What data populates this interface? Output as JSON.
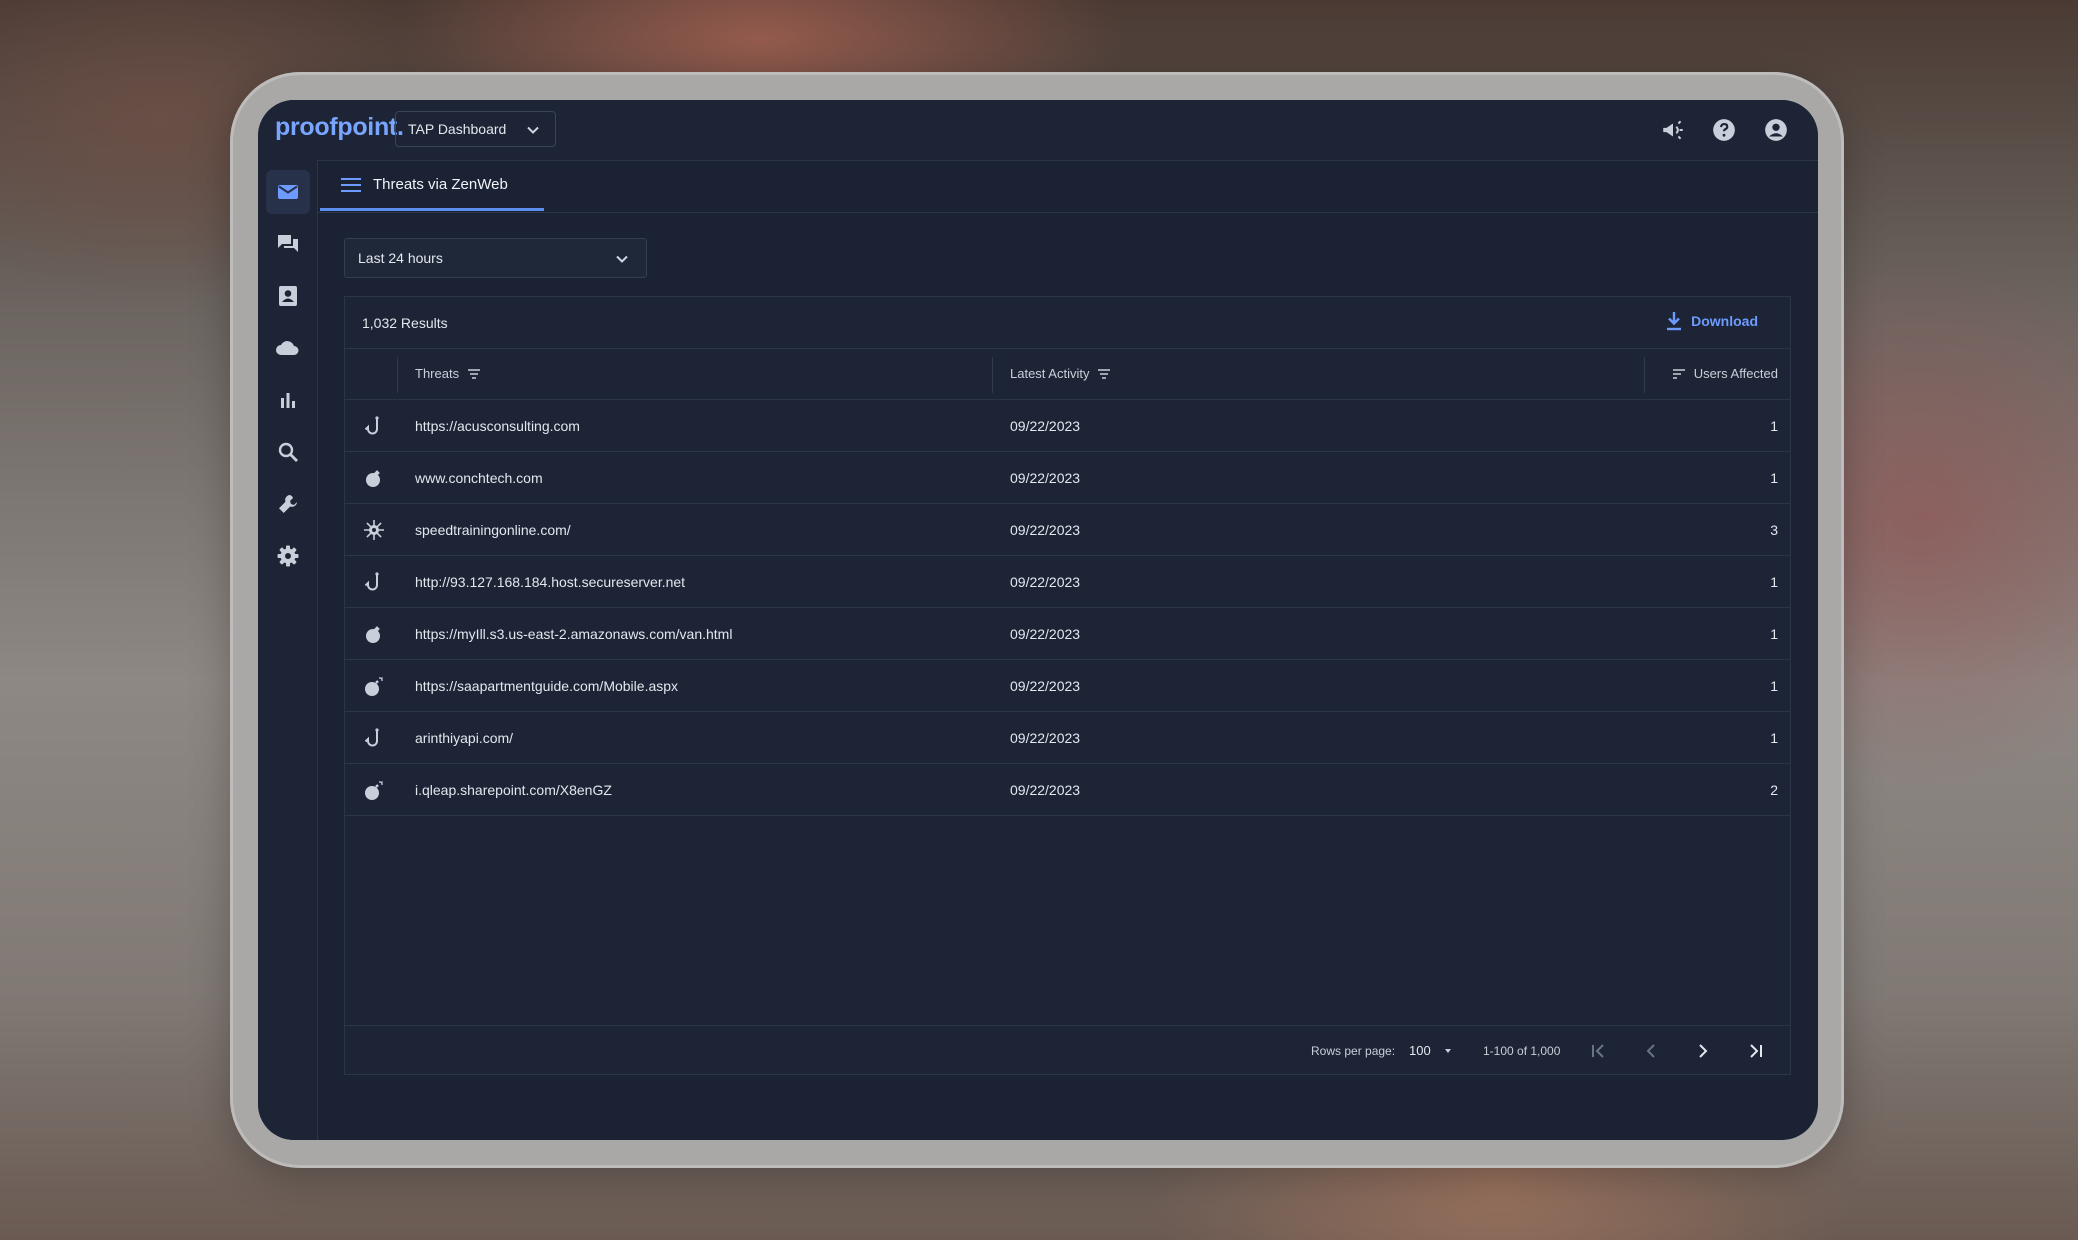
{
  "app": {
    "logo_text": "proofpoint.",
    "dashboard_selector": "TAP Dashboard",
    "accent_color": "#5b8def"
  },
  "topbar_icons": [
    "megaphone-icon",
    "help-icon",
    "account-icon"
  ],
  "sidebar": {
    "items": [
      {
        "icon": "mail-icon",
        "active": true
      },
      {
        "icon": "chat-icon",
        "active": false
      },
      {
        "icon": "contact-card-icon",
        "active": false
      },
      {
        "icon": "cloud-icon",
        "active": false
      },
      {
        "icon": "bar-chart-icon",
        "active": false
      },
      {
        "icon": "search-icon",
        "active": false
      },
      {
        "icon": "wrench-icon",
        "active": false
      },
      {
        "icon": "gear-icon",
        "active": false
      }
    ],
    "bottom_icon": "panel-toggle-icon"
  },
  "tab": {
    "label": "Threats via ZenWeb"
  },
  "filter": {
    "time_range": "Last 24 hours"
  },
  "table": {
    "results_count": "1,032 Results",
    "download_label": "Download",
    "columns": {
      "threats": "Threats",
      "latest_activity": "Latest Activity",
      "users_affected": "Users Affected"
    },
    "rows": [
      {
        "type": "phish-hook-icon",
        "threat": "https://acusconsulting.com",
        "date": "09/22/2023",
        "users": "1"
      },
      {
        "type": "malware-bomb-icon",
        "threat": "www.conchtech.com",
        "date": "09/22/2023",
        "users": "1"
      },
      {
        "type": "virus-icon",
        "threat": "speedtrainingonline.com/",
        "date": "09/22/2023",
        "users": "3"
      },
      {
        "type": "phish-hook-icon",
        "threat": "http://93.127.168.184.host.secureserver.net",
        "date": "09/22/2023",
        "users": "1"
      },
      {
        "type": "malware-bomb-icon",
        "threat": "https://myIll.s3.us-east-2.amazonaws.com/van.html",
        "date": "09/22/2023",
        "users": "1"
      },
      {
        "type": "malware-bomb-lit-icon",
        "threat": "https://saapartmentguide.com/Mobile.aspx",
        "date": "09/22/2023",
        "users": "1"
      },
      {
        "type": "phish-hook-icon",
        "threat": "arinthiyapi.com/",
        "date": "09/22/2023",
        "users": "1"
      },
      {
        "type": "malware-bomb-lit-icon",
        "threat": "i.qleap.sharepoint.com/X8enGZ",
        "date": "09/22/2023",
        "users": "2"
      }
    ]
  },
  "pagination": {
    "rows_per_page_label": "Rows per page:",
    "rows_per_page": "100",
    "range": "1-100 of 1,000"
  }
}
